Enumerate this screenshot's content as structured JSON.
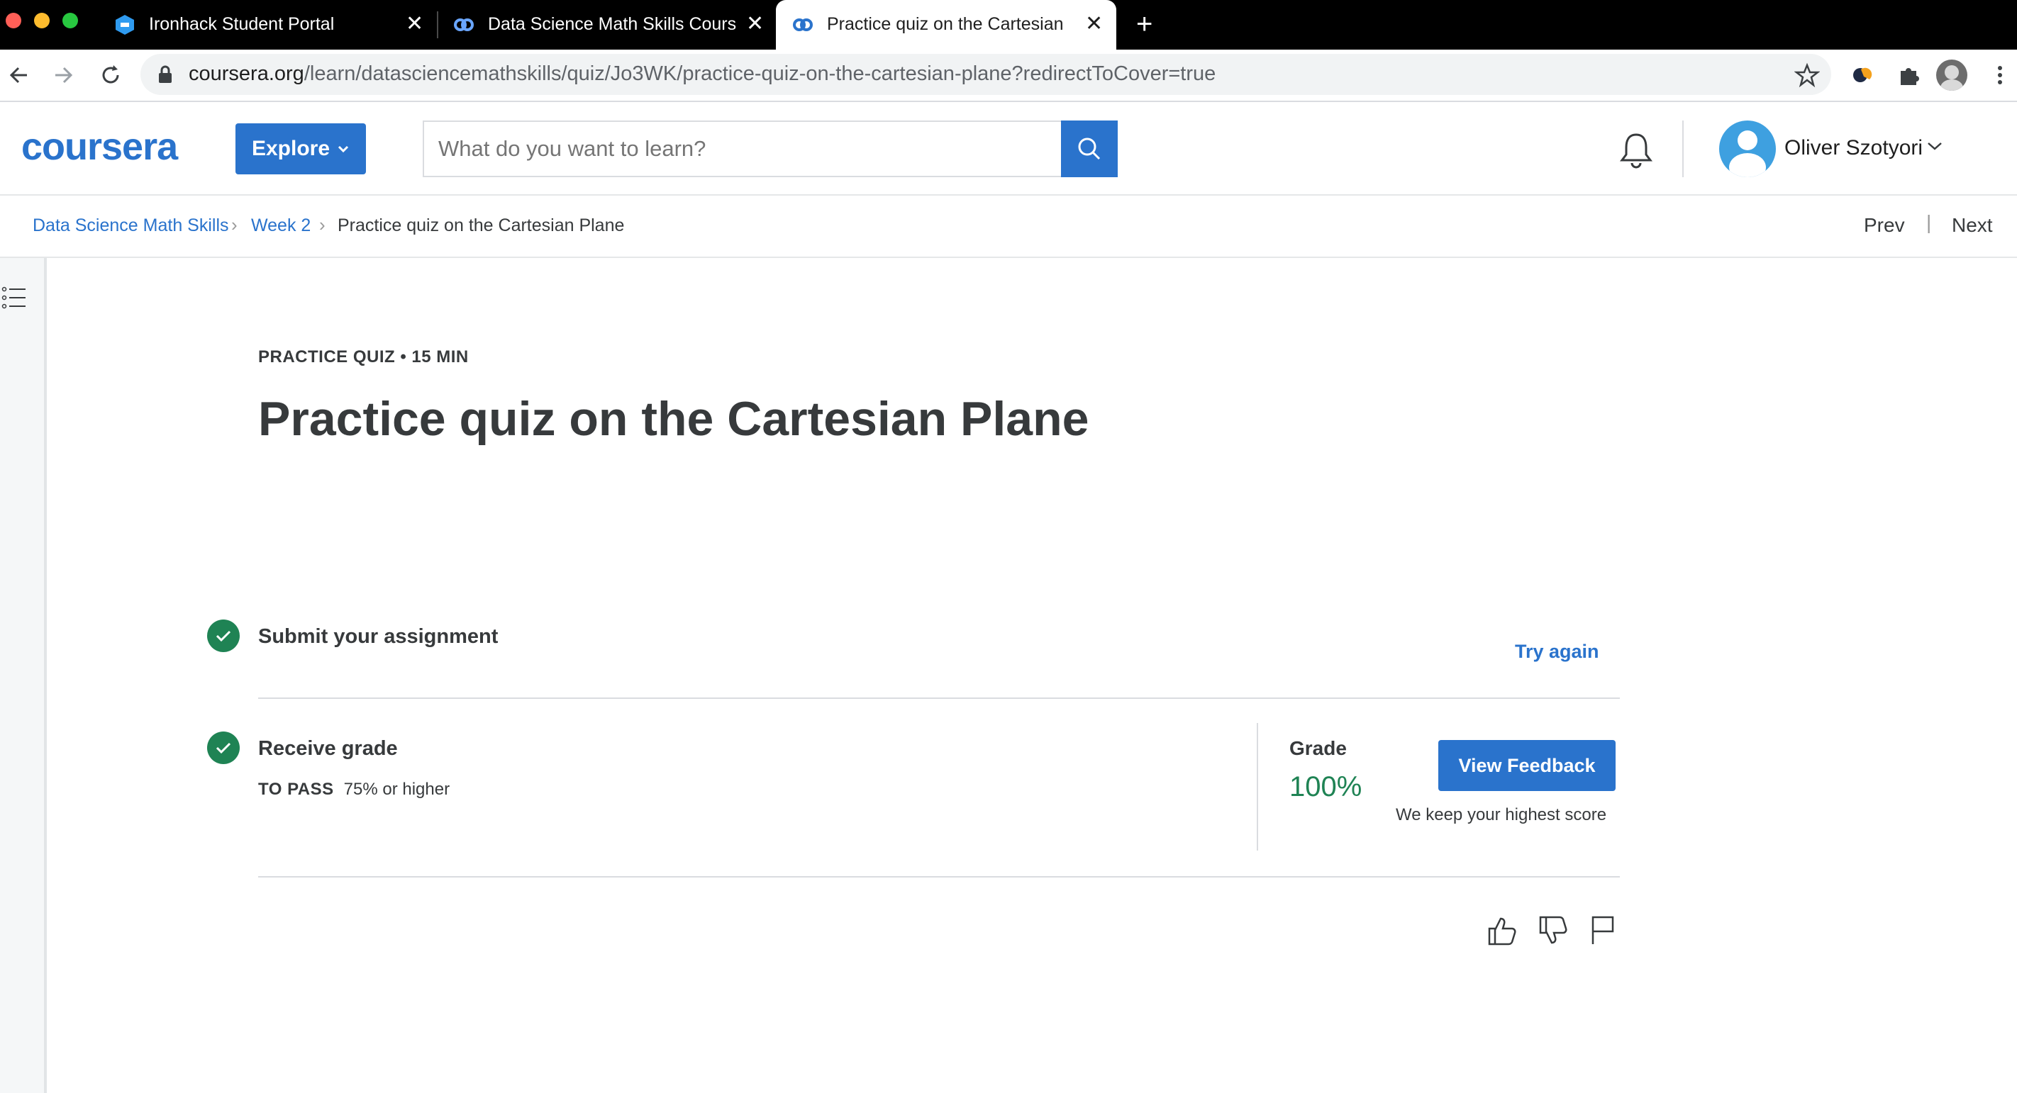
{
  "browser": {
    "tabs": [
      {
        "title": "Ironhack Student Portal",
        "active": false
      },
      {
        "title": "Data Science Math Skills Cours",
        "active": false
      },
      {
        "title": "Practice quiz on the Cartesian",
        "active": true
      }
    ],
    "url_host": "coursera.org",
    "url_path": "/learn/datasciencemathskills/quiz/Jo3WK/practice-quiz-on-the-cartesian-plane?redirectToCover=true"
  },
  "header": {
    "logo": "coursera",
    "explore_label": "Explore",
    "search_placeholder": "What do you want to learn?",
    "user_name": "Oliver Szotyori"
  },
  "breadcrumb": {
    "items": [
      "Data Science Math Skills",
      "Week 2",
      "Practice quiz on the Cartesian Plane"
    ],
    "prev_label": "Prev",
    "next_label": "Next"
  },
  "quiz": {
    "kicker": "PRACTICE QUIZ • 15 MIN",
    "title": "Practice quiz on the Cartesian Plane",
    "step1": {
      "label": "Submit your assignment",
      "action": "Try again"
    },
    "step2": {
      "label": "Receive grade",
      "to_pass_key": "TO PASS",
      "to_pass_value": "75% or higher",
      "grade_label": "Grade",
      "grade_value": "100%",
      "button_label": "View Feedback",
      "note": "We keep your highest score"
    }
  },
  "colors": {
    "brand": "#2a73cc",
    "success": "#1f8354",
    "text": "#373a3c"
  }
}
